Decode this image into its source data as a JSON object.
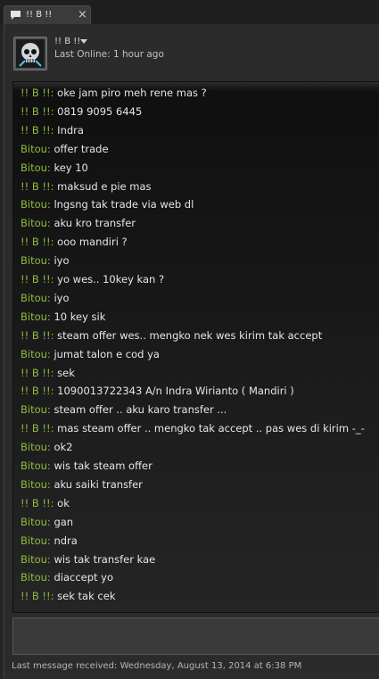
{
  "tab": {
    "title": "!! B !!",
    "close_label": "×",
    "icon": "chat-bubble-icon"
  },
  "header": {
    "friend_name": "!! B !!",
    "status": "Last Online: 1 hour ago",
    "dropdown_icon": "chevron-down-icon",
    "avatar_icon": "skull-avatar-icon"
  },
  "colors": {
    "friend_sender": "#8fbc3d",
    "self_sender": "#8fbc3d",
    "message_text": "#e6e6e6"
  },
  "messages": [
    {
      "sender": "!! B !!:",
      "text": " oke jam piro meh rene mas ?"
    },
    {
      "sender": "!! B !!:",
      "text": " 0819 9095 6445"
    },
    {
      "sender": "!! B !!:",
      "text": " Indra"
    },
    {
      "sender": "Bitou:",
      "text": " offer trade"
    },
    {
      "sender": "Bitou:",
      "text": " key 10"
    },
    {
      "sender": "!! B !!:",
      "text": " maksud e pie mas"
    },
    {
      "sender": "Bitou:",
      "text": " lngsng tak trade via web dl"
    },
    {
      "sender": "Bitou:",
      "text": " aku kro transfer"
    },
    {
      "sender": "!! B !!:",
      "text": " ooo mandiri ?"
    },
    {
      "sender": "Bitou:",
      "text": " iyo"
    },
    {
      "sender": "!! B !!:",
      "text": " yo wes.. 10key kan ?"
    },
    {
      "sender": "Bitou:",
      "text": " iyo"
    },
    {
      "sender": "Bitou:",
      "text": " 10 key sik"
    },
    {
      "sender": "!! B !!:",
      "text": " steam offer wes.. mengko nek wes kirim tak accept"
    },
    {
      "sender": "Bitou:",
      "text": " jumat talon e cod ya"
    },
    {
      "sender": "!! B !!:",
      "text": " sek"
    },
    {
      "sender": "!! B !!:",
      "text": " 1090013722343 A/n Indra Wirianto ( Mandiri )"
    },
    {
      "sender": "Bitou:",
      "text": " steam offer .. aku karo transfer ..."
    },
    {
      "sender": "!! B !!:",
      "text": " mas steam offer .. mengko tak accept .. pas wes di kirim -_-"
    },
    {
      "sender": "Bitou:",
      "text": " ok2"
    },
    {
      "sender": "Bitou:",
      "text": " wis tak steam offer"
    },
    {
      "sender": "Bitou:",
      "text": " aku saiki transfer"
    },
    {
      "sender": "!! B !!:",
      "text": " ok"
    },
    {
      "sender": "Bitou:",
      "text": " gan"
    },
    {
      "sender": "Bitou:",
      "text": " ndra"
    },
    {
      "sender": "Bitou:",
      "text": " wis tak transfer kae"
    },
    {
      "sender": "Bitou:",
      "text": " diaccept yo"
    },
    {
      "sender": "!! B !!:",
      "text": " sek tak cek"
    }
  ],
  "input": {
    "value": ""
  },
  "footer": {
    "text": "Last message received: Wednesday, August 13, 2014 at 6:38 PM"
  }
}
